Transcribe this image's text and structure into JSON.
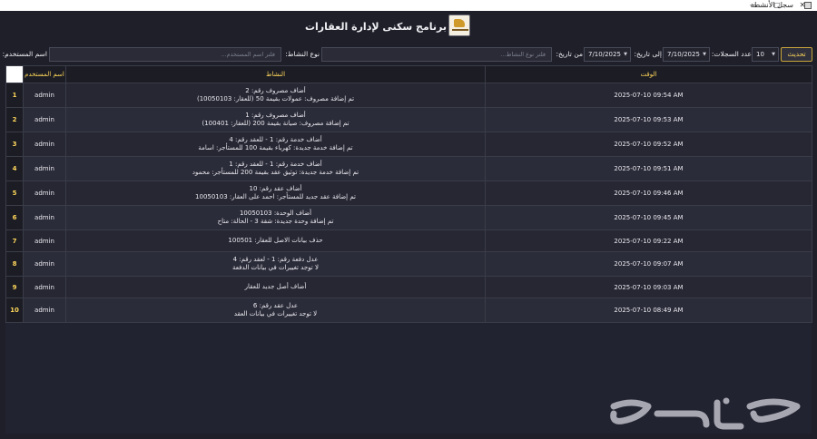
{
  "window": {
    "title": "سجل الأنشطة",
    "min": "—",
    "max": "▢",
    "close": "✕"
  },
  "header": {
    "title": "برنامج سكنى لإدارة العقارات"
  },
  "filters": {
    "refresh_label": "تحديث",
    "records_label": "عدد السجلات:",
    "records_value": "10",
    "to_date_label": "إلى تاريخ:",
    "to_date_value": "7/10/2025",
    "from_date_label": "من تاريخ:",
    "from_date_value": "7/10/2025",
    "activity_type_label": "نوع النشاط:",
    "activity_type_placeholder": "فلتر نوع النشاط...",
    "username_label": "اسم المستخدم:",
    "username_placeholder": "فلتر اسم المستخدم..."
  },
  "table": {
    "headers": {
      "user": "اسم المستخدم",
      "activity": "النشاط",
      "time": "الوقت"
    },
    "rows": [
      {
        "num": "1",
        "user": "admin",
        "line1": "أضاف مصروف رقم: 2",
        "line2": "تم إضافة مصروف: عمولات بقيمة 50 (للعقار: 10050103)",
        "time": "2025-07-10 09:54 AM"
      },
      {
        "num": "2",
        "user": "admin",
        "line1": "أضاف مصروف رقم: 1",
        "line2": "تم إضافة مصروف: صيانة بقيمة 200 (للعقار: 100401)",
        "time": "2025-07-10 09:53 AM"
      },
      {
        "num": "3",
        "user": "admin",
        "line1": "أضاف خدمة رقم: 1 - للعقد رقم: 4",
        "line2": "تم إضافة خدمة جديدة: كهرباء بقيمة 100 للمستأجر: اسامة",
        "time": "2025-07-10 09:52 AM"
      },
      {
        "num": "4",
        "user": "admin",
        "line1": "أضاف خدمة رقم: 1 - للعقد رقم: 1",
        "line2": "تم إضافة خدمة جديدة: توثيق عقد بقيمة 200 للمستأجر: محمود",
        "time": "2025-07-10 09:51 AM"
      },
      {
        "num": "5",
        "user": "admin",
        "line1": "أضاف عقد رقم: 10",
        "line2": "تم إضافة عقد جديد للمستأجر: احمد على العقار: 10050103",
        "time": "2025-07-10 09:46 AM"
      },
      {
        "num": "6",
        "user": "admin",
        "line1": "أضاف الوحدة: 10050103",
        "line2": "تم إضافة وحدة جديدة: شقة 3 - الحالة: متاح",
        "time": "2025-07-10 09:45 AM"
      },
      {
        "num": "7",
        "user": "admin",
        "line1": "حذف بيانات الاصل للعقار: 100501",
        "line2": "",
        "time": "2025-07-10 09:22 AM"
      },
      {
        "num": "8",
        "user": "admin",
        "line1": "عدل دفعة رقم: 1 - لعقد رقم: 4",
        "line2": "لا توجد تغييرات في بيانات الدفعة",
        "time": "2025-07-10 09:07 AM"
      },
      {
        "num": "9",
        "user": "admin",
        "line1": "أضاف أصل جديد للعقار",
        "line2": "",
        "time": "2025-07-10 09:03 AM"
      },
      {
        "num": "10",
        "user": "admin",
        "line1": "عدل عقد رقم: 6",
        "line2": "لا توجد تغييرات في بيانات العقد",
        "time": "2025-07-10 08:49 AM"
      }
    ]
  },
  "watermark": {
    "logo_text": "حراج"
  }
}
